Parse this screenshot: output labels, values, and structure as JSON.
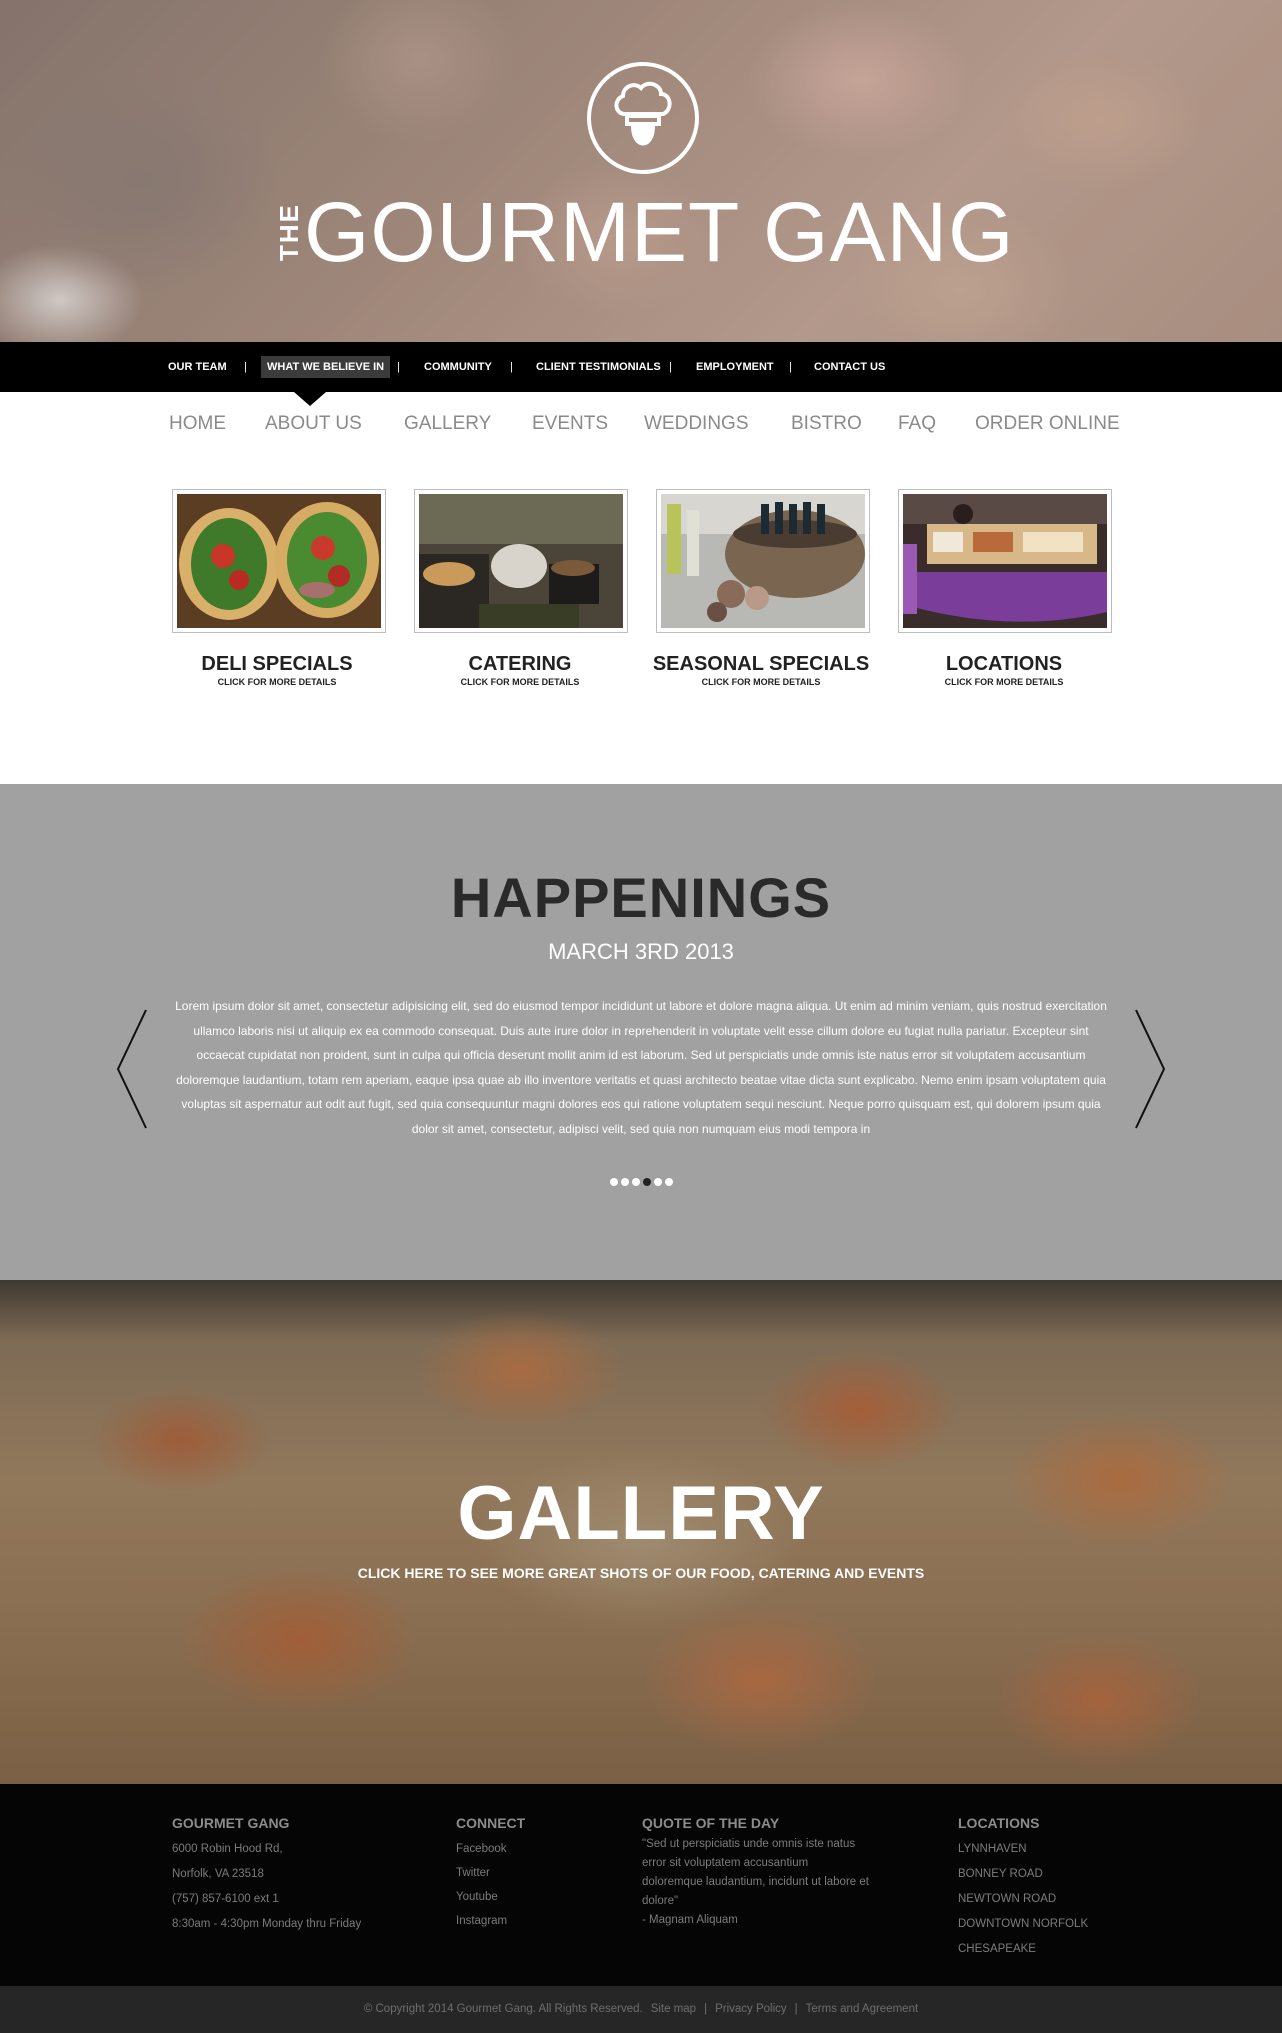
{
  "hero": {
    "logo_prefix": "THE",
    "logo_name": "GOURMET GANG"
  },
  "topnav": {
    "items": [
      {
        "label": "OUR TEAM"
      },
      {
        "label": "WHAT WE BELIEVE IN",
        "active": true
      },
      {
        "label": "COMMUNITY"
      },
      {
        "label": "CLIENT TESTIMONIALS"
      },
      {
        "label": "EMPLOYMENT"
      },
      {
        "label": "CONTACT US"
      }
    ],
    "separator": "|"
  },
  "mainnav": {
    "items": [
      "HOME",
      "ABOUT US",
      "GALLERY",
      "EVENTS",
      "WEDDINGS",
      "BISTRO",
      "FAQ",
      "ORDER ONLINE"
    ]
  },
  "features": [
    {
      "title": "DELI SPECIALS",
      "subtitle": "CLICK FOR MORE DETAILS"
    },
    {
      "title": "CATERING",
      "subtitle": "CLICK FOR MORE DETAILS"
    },
    {
      "title": "SEASONAL SPECIALS",
      "subtitle": "CLICK FOR MORE DETAILS"
    },
    {
      "title": "LOCATIONS",
      "subtitle": "CLICK FOR MORE DETAILS"
    }
  ],
  "happenings": {
    "title": "HAPPENINGS",
    "date": "MARCH 3RD 2013",
    "body": "Lorem ipsum dolor sit amet, consectetur adipisicing elit, sed do eiusmod tempor incididunt ut labore et dolore magna aliqua. Ut enim ad minim veniam, quis nostrud exercitation ullamco laboris nisi ut aliquip ex ea commodo consequat. Duis aute irure dolor in reprehenderit in voluptate velit esse cillum dolore eu fugiat nulla pariatur. Excepteur sint occaecat cupidatat non proident, sunt in culpa qui officia deserunt mollit anim id est laborum. Sed ut perspiciatis unde omnis iste natus error sit voluptatem accusantium doloremque laudantium, totam rem aperiam, eaque ipsa quae ab illo inventore veritatis et quasi architecto beatae vitae dicta sunt explicabo. Nemo enim ipsam voluptatem quia voluptas sit aspernatur aut odit aut fugit, sed quia consequuntur magni dolores eos qui ratione voluptatem sequi nesciunt. Neque porro quisquam est, qui dolorem ipsum quia dolor sit amet, consectetur, adipisci velit, sed quia non numquam eius modi tempora in",
    "slide_count": 6,
    "active_slide": 4
  },
  "gallery": {
    "title": "GALLERY",
    "subtitle": "CLICK HERE TO SEE MORE GREAT SHOTS OF OUR FOOD, CATERING AND EVENTS"
  },
  "footer": {
    "company": {
      "heading": "GOURMET GANG",
      "address1": "6000 Robin Hood Rd,",
      "address2": "Norfolk, VA 23518",
      "phone": "(757) 857-6100 ext 1",
      "hours": "8:30am - 4:30pm Monday thru Friday"
    },
    "connect": {
      "heading": "CONNECT",
      "links": [
        "Facebook",
        "Twitter",
        "Youtube",
        "Instagram"
      ]
    },
    "quote": {
      "heading": "QUOTE OF THE DAY",
      "text": "\"Sed ut perspiciatis unde omnis iste natus error sit voluptatem accusantium doloremque laudantium, incidunt ut labore et dolore\"",
      "author": "- Magnam Aliquam"
    },
    "locations": {
      "heading": "LOCATIONS",
      "items": [
        "LYNNHAVEN",
        "BONNEY ROAD",
        "NEWTOWN ROAD",
        "DOWNTOWN NORFOLK",
        "CHESAPEAKE"
      ]
    }
  },
  "bottom": {
    "copyright": "© Copyright 2014 Gourmet Gang. All Rights Reserved.",
    "sitemap": "Site map",
    "privacy": "Privacy Policy",
    "terms": "Terms and Agreement",
    "separator": "|"
  },
  "colors": {
    "topbar": "#000000",
    "happenings_bg": "#a1a1a1",
    "footer_bg": "#050505",
    "bottombar_bg": "#262626"
  }
}
